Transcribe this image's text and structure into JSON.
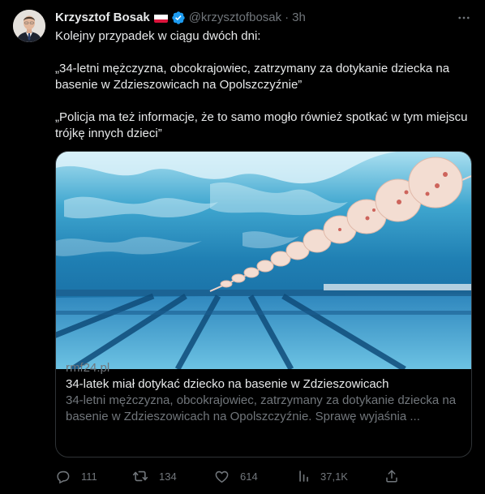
{
  "author": {
    "name": "Krzysztof Bosak",
    "handle": "@krzysztofbosak",
    "separator": "·",
    "time": "3h"
  },
  "tweet": {
    "lines": [
      "Kolejny przypadek w ciągu dwóch dni:",
      "„34-letni mężczyzna, obcokrajowiec, zatrzymany za dotykanie dziecka na basenie w Zdzieszowicach na Opolszczyźnie”",
      "„Policja ma też informacje, że to samo mogło również spotkać w tym miejscu trójkę innych dzieci”"
    ]
  },
  "card": {
    "domain": "rmf24.pl",
    "title": "34-latek miał dotykać dziecko na basenie w Zdzieszowicach",
    "description": "34-letni mężczyzna, obcokrajowiec, zatrzymany za dotykanie dziecka na basenie w Zdzieszowicach na Opolszczyźnie. Sprawę wyjaśnia ...",
    "image_icon": "swimming-pool-photo"
  },
  "actions": {
    "reply": {
      "count": "111",
      "icon": "reply-icon"
    },
    "retweet": {
      "count": "134",
      "icon": "retweet-icon"
    },
    "like": {
      "count": "614",
      "icon": "heart-icon"
    },
    "views": {
      "count": "37,1K",
      "icon": "views-icon"
    },
    "share": {
      "icon": "share-icon"
    }
  },
  "colors": {
    "background": "#000000",
    "text": "#e7e9ea",
    "muted": "#71767b",
    "verified": "#1d9bf0",
    "border": "#2f3336"
  }
}
